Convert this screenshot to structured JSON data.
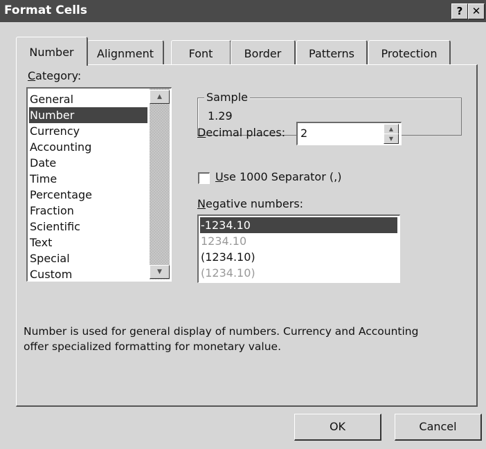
{
  "window": {
    "title": "Format Cells",
    "help_label": "?",
    "close_label": "✕"
  },
  "tabs": [
    "Number",
    "Alignment",
    "Font",
    "Border",
    "Patterns",
    "Protection"
  ],
  "category": {
    "label_first": "C",
    "label_rest": "ategory:",
    "items": [
      "General",
      "Number",
      "Currency",
      "Accounting",
      "Date",
      "Time",
      "Percentage",
      "Fraction",
      "Scientific",
      "Text",
      "Special",
      "Custom"
    ],
    "selected": "Number"
  },
  "sample": {
    "label": "Sample",
    "value": "1.29"
  },
  "decimal_places": {
    "label_first": "D",
    "label_rest": "ecimal places:",
    "value": "2"
  },
  "separator": {
    "label_first": "U",
    "label_rest": "se 1000 Separator (,)",
    "checked": false
  },
  "negative_numbers": {
    "label_first": "N",
    "label_rest": "egative numbers:",
    "items": [
      "-1234.10",
      "1234.10",
      "(1234.10)",
      "(1234.10)"
    ],
    "selected": "-1234.10"
  },
  "description": {
    "line1": "Number is used for general display of numbers.  Currency and Accounting",
    "line2": "offer specialized formatting for monetary value."
  },
  "buttons": {
    "ok": "OK",
    "cancel": "Cancel"
  },
  "colors": {
    "title_bar": "#4a4a4a",
    "selection": "#444444",
    "dialog_bg": "#d6d6d6"
  }
}
